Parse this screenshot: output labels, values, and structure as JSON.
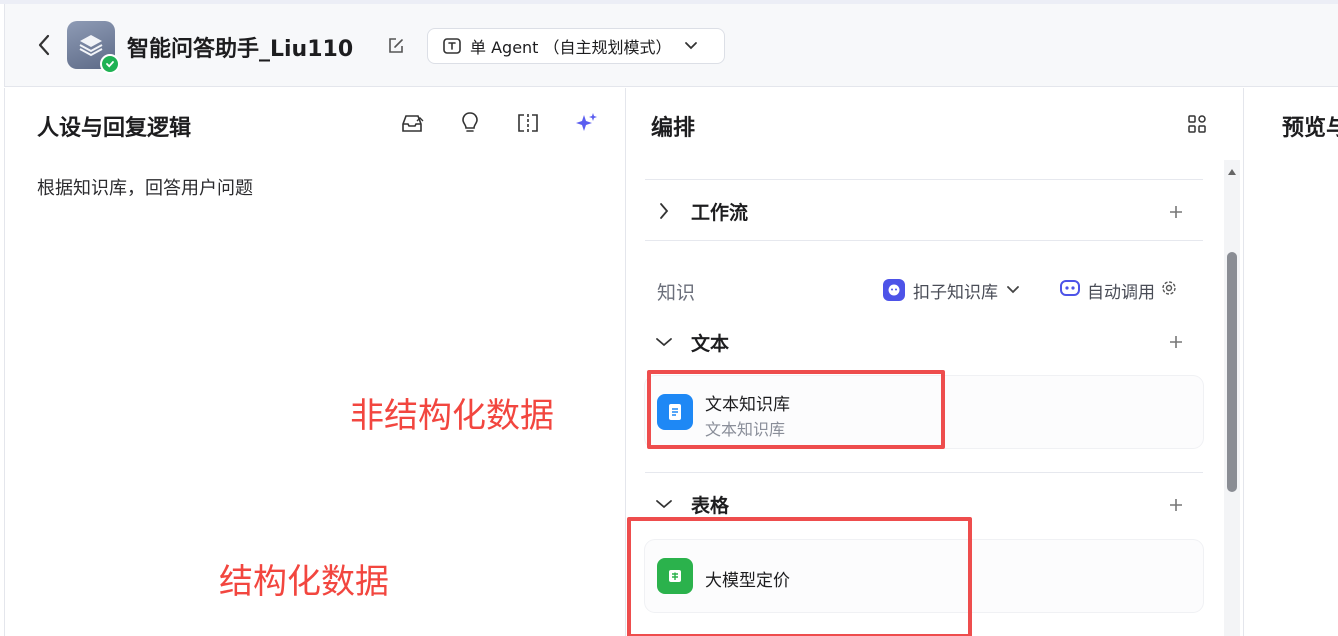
{
  "header": {
    "app_name": "智能问答助手_Liu110",
    "mode_label": "单 Agent （自主规划模式）"
  },
  "persona": {
    "title": "人设与回复逻辑",
    "prompt": "根据知识库，回答用户问题"
  },
  "annotations": {
    "unstructured": "非结构化数据",
    "structured": "结构化数据"
  },
  "orchestration": {
    "title": "编排",
    "workflow_label": "工作流",
    "knowledge_label": "知识",
    "kb_source": "扣子知识库",
    "auto_call": "自动调用",
    "text_section": "文本",
    "table_section": "表格",
    "text_card": {
      "title": "文本知识库",
      "subtitle": "文本知识库"
    },
    "table_card": {
      "title": "大模型定价"
    }
  },
  "preview": {
    "title": "预览与"
  },
  "colors": {
    "accent": "#4d53e8",
    "annotation_red": "#ee4d4d",
    "text_kb_icon": "#1e88f5",
    "table_kb_icon": "#2bb24c"
  }
}
